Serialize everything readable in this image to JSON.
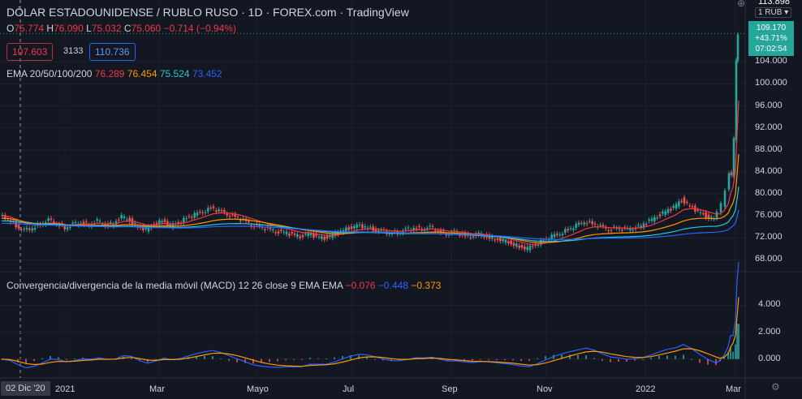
{
  "header": {
    "title": "DÓLAR ESTADOUNIDENSE / RUBLO RUSO · 1D · FOREX.com · TradingView",
    "ohlc": {
      "o_label": "O",
      "o_value": "75.774",
      "h_label": "H",
      "h_value": "76.090",
      "l_label": "L",
      "l_value": "75.032",
      "c_label": "C",
      "c_value": "75.060",
      "change": "−0.714 (−0.94%)"
    },
    "bid": "107.603",
    "spread": "3133",
    "ask": "110.736",
    "ema_label": "EMA 20/50/100/200",
    "ema_values": [
      "76.289",
      "76.454",
      "75.524",
      "73.452"
    ],
    "ema_colors": [
      "#f23645",
      "#ff9800",
      "#26c6da",
      "#2962ff"
    ]
  },
  "currency_unit": "1 RUB ▾",
  "top_price": "113.898",
  "price_tag": {
    "line1": "109.170",
    "line2": "+43.71%",
    "line3": "07:02:54",
    "color": "#26a69a"
  },
  "cursor_date": "02 Dic '20",
  "macd_label": {
    "text": "Convergencia/divergencia de la media móvil (MACD) 12 26 close 9 EMA EMA",
    "values": [
      "−0.076",
      "−0.448",
      "−0.373"
    ],
    "colors": [
      "#f23645",
      "#2962ff",
      "#ff9800"
    ]
  },
  "chart_data": [
    {
      "type": "line",
      "title": "DÓLAR ESTADOUNIDENSE / RUBLO RUSO",
      "x_ticks": [
        "2021",
        "Mar",
        "Mayo",
        "Jul",
        "Sep",
        "Nov",
        "2022",
        "Mar"
      ],
      "y_ticks": [
        "68.000",
        "72.000",
        "76.000",
        "80.000",
        "84.000",
        "88.000",
        "92.000",
        "96.000",
        "100.000",
        "104.000"
      ],
      "ylim": [
        66,
        112
      ],
      "price_close_points": [
        [
          0,
          76.0
        ],
        [
          10,
          75.5
        ],
        [
          20,
          74.2
        ],
        [
          30,
          73.3
        ],
        [
          40,
          73.8
        ],
        [
          50,
          74.5
        ],
        [
          60,
          75.2
        ],
        [
          70,
          74.6
        ],
        [
          80,
          73.8
        ],
        [
          90,
          74.4
        ],
        [
          100,
          74.8
        ],
        [
          110,
          74.4
        ],
        [
          120,
          75.0
        ],
        [
          130,
          74.3
        ],
        [
          140,
          74.6
        ],
        [
          150,
          75.8
        ],
        [
          160,
          75.2
        ],
        [
          170,
          74.0
        ],
        [
          180,
          73.5
        ],
        [
          190,
          74.5
        ],
        [
          200,
          75.1
        ],
        [
          210,
          74.2
        ],
        [
          220,
          74.8
        ],
        [
          230,
          75.6
        ],
        [
          240,
          76.2
        ],
        [
          250,
          76.8
        ],
        [
          260,
          77.4
        ],
        [
          270,
          76.9
        ],
        [
          280,
          76.4
        ],
        [
          290,
          75.8
        ],
        [
          300,
          75.2
        ],
        [
          310,
          74.4
        ],
        [
          320,
          74.0
        ],
        [
          330,
          73.6
        ],
        [
          340,
          73.2
        ],
        [
          350,
          73.0
        ],
        [
          360,
          72.6
        ],
        [
          370,
          72.3
        ],
        [
          380,
          72.8
        ],
        [
          390,
          72.2
        ],
        [
          400,
          72.0
        ],
        [
          410,
          72.5
        ],
        [
          420,
          73.2
        ],
        [
          430,
          73.8
        ],
        [
          440,
          74.2
        ],
        [
          450,
          74.0
        ],
        [
          460,
          73.6
        ],
        [
          470,
          73.2
        ],
        [
          480,
          72.9
        ],
        [
          490,
          73.0
        ],
        [
          500,
          73.4
        ],
        [
          510,
          73.8
        ],
        [
          520,
          73.6
        ],
        [
          530,
          73.9
        ],
        [
          540,
          73.2
        ],
        [
          550,
          72.8
        ],
        [
          560,
          73.0
        ],
        [
          570,
          72.6
        ],
        [
          580,
          72.3
        ],
        [
          590,
          72.6
        ],
        [
          600,
          72.2
        ],
        [
          610,
          71.8
        ],
        [
          620,
          71.5
        ],
        [
          630,
          71.0
        ],
        [
          640,
          70.4
        ],
        [
          650,
          70.0
        ],
        [
          660,
          70.8
        ],
        [
          670,
          71.5
        ],
        [
          680,
          72.2
        ],
        [
          690,
          72.8
        ],
        [
          700,
          73.5
        ],
        [
          710,
          74.2
        ],
        [
          720,
          75.0
        ],
        [
          730,
          74.6
        ],
        [
          740,
          74.0
        ],
        [
          750,
          73.6
        ],
        [
          760,
          73.8
        ],
        [
          770,
          73.5
        ],
        [
          780,
          73.8
        ],
        [
          790,
          74.2
        ],
        [
          800,
          75.0
        ],
        [
          810,
          76.0
        ],
        [
          820,
          76.8
        ],
        [
          830,
          77.5
        ],
        [
          840,
          79.0
        ],
        [
          850,
          77.8
        ],
        [
          860,
          76.8
        ],
        [
          870,
          76.0
        ],
        [
          880,
          75.4
        ],
        [
          885,
          76.5
        ],
        [
          890,
          78.0
        ],
        [
          895,
          80.5
        ],
        [
          898,
          84.0
        ],
        [
          901,
          83.5
        ],
        [
          904,
          90.0
        ],
        [
          906,
          104.0
        ],
        [
          908,
          109.17
        ]
      ],
      "ema_series": [
        {
          "name": "EMA 20",
          "color": "#f23645"
        },
        {
          "name": "EMA 50",
          "color": "#ff9800"
        },
        {
          "name": "EMA 100",
          "color": "#26c6da"
        },
        {
          "name": "EMA 200",
          "color": "#2962ff"
        }
      ]
    },
    {
      "type": "line",
      "title": "Convergencia/divergencia de la media móvil (MACD) 12 26 close 9 EMA EMA",
      "y_ticks": [
        "0.000",
        "2.000",
        "4.000"
      ],
      "ylim": [
        -1.4,
        6.2
      ],
      "series": [
        {
          "name": "MACD",
          "color": "#2962ff"
        },
        {
          "name": "Signal",
          "color": "#ff9800"
        },
        {
          "name": "Histogram",
          "color": "#26a69a"
        }
      ]
    }
  ]
}
